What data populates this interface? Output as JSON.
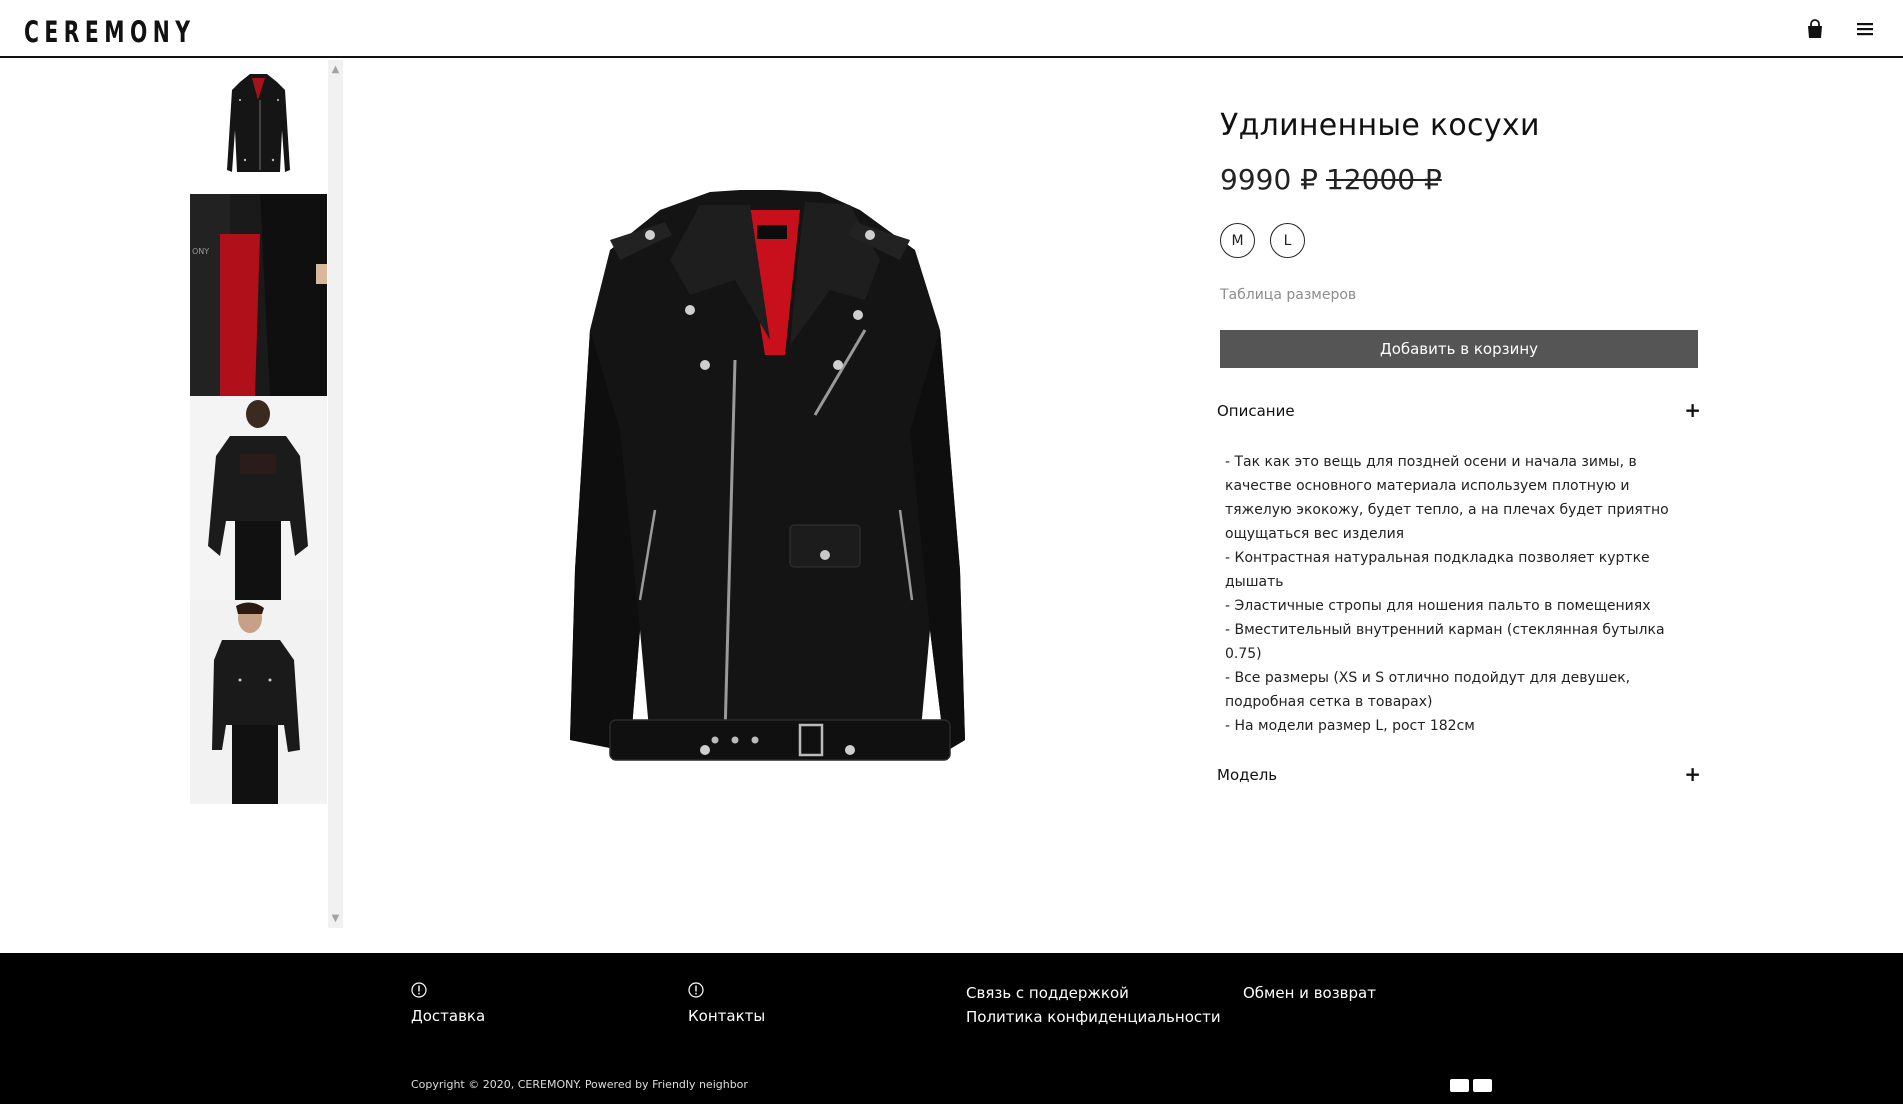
{
  "header": {
    "logo": "CEREMONY",
    "icons": [
      "shopping-bag-icon",
      "hamburger-menu-icon"
    ]
  },
  "gallery": {
    "thumbnails": [
      "jacket-front-thumb",
      "jacket-lining-thumb",
      "model-back-thumb",
      "model-front-thumb"
    ],
    "main_image": "jacket-front-main"
  },
  "product": {
    "title": "Удлиненные косухи",
    "price_new": "9990 ₽",
    "price_old": "12000 ₽",
    "sizes": [
      "M",
      "L"
    ],
    "size_table_link": "Таблица размеров",
    "add_to_cart": "Добавить в корзину",
    "accordion": {
      "description_title": "Описание",
      "description_lines": [
        " - Так как это вещь для поздней осени и начала зимы, в",
        "качестве основного материала используем плотную и",
        "тяжелую экокожу, будет тепло, а на плечах будет приятно",
        "ощущаться вес изделия",
        " - Контрастная натуральная подкладка позволяет куртке",
        "дышать",
        " - Эластичные стропы для ношения пальто в помещениях",
        " - Вместительный внутренний карман (стеклянная бутылка",
        "0.75)",
        " - Все размеры (XS и S отлично подойдут для девушек,",
        "подробная сетка в товарах)",
        " - На модели размер L, рост 182см"
      ],
      "model_title": "Модель",
      "expand_symbol": "+"
    }
  },
  "footer": {
    "delivery": "Доставка",
    "contacts": "Контакты",
    "support": "Связь с поддержкой",
    "privacy": "Политика конфиденциальности",
    "returns": "Обмен и возврат",
    "copyright": "Copyright © 2020, CEREMONY. Powered by Friendly neighbor",
    "payment_icons": [
      "visa-icon",
      "mastercard-icon"
    ]
  },
  "colors": {
    "button_bg": "#555555",
    "footer_bg": "#000000",
    "lining_red": "#c8101c"
  }
}
